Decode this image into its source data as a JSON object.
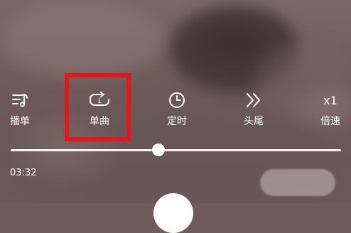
{
  "controls": {
    "playlist": {
      "label": "播单",
      "icon": "playlist-icon"
    },
    "single_loop": {
      "label": "单曲",
      "icon": "repeat-one-icon"
    },
    "timer": {
      "label": "定时",
      "icon": "clock-icon"
    },
    "head_tail": {
      "label": "头尾",
      "icon": "double-chevron-right-icon"
    },
    "speed": {
      "label": "倍速",
      "value": "x1"
    }
  },
  "progress": {
    "current_time": "03:32",
    "fraction": 0.448
  },
  "colors": {
    "highlight": "#e8141b",
    "foreground": "#ffffff"
  }
}
